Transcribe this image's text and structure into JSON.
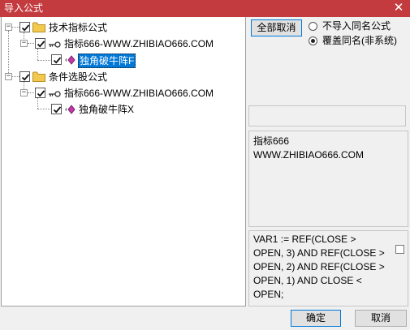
{
  "window": {
    "title": "导入公式"
  },
  "tree": {
    "nodes": [
      {
        "label": "技术指标公式",
        "expander": "−",
        "checked": true,
        "icon": "folder-icon"
      },
      {
        "label": "指标666-WWW.ZHIBIAO666.COM",
        "expander": "−",
        "checked": true,
        "icon": "key-icon"
      },
      {
        "label": "独角破牛阵F",
        "expander": "",
        "checked": true,
        "icon": "diamond-icon",
        "selected": true
      },
      {
        "label": "条件选股公式",
        "expander": "−",
        "checked": true,
        "icon": "folder-icon"
      },
      {
        "label": "指标666-WWW.ZHIBIAO666.COM",
        "expander": "−",
        "checked": true,
        "icon": "key-icon"
      },
      {
        "label": "独角破牛阵X",
        "expander": "",
        "checked": true,
        "icon": "diamond-icon"
      }
    ]
  },
  "actions": {
    "cancel_all_label": "全部取消"
  },
  "options": {
    "no_import_same_name": {
      "label": "不导入同名公式",
      "selected": false
    },
    "overwrite_same_name": {
      "label": "覆盖同名(非系统)",
      "selected": true
    }
  },
  "description": {
    "lines": [
      "指标666",
      "WWW.ZHIBIAO666.COM"
    ]
  },
  "code": {
    "lines": [
      "VAR1 := REF(CLOSE >",
      "OPEN, 3) AND REF(CLOSE >",
      "OPEN, 2) AND REF(CLOSE >",
      "OPEN, 1) AND CLOSE <",
      "OPEN;"
    ],
    "checked": false
  },
  "footer": {
    "ok_label": "确定",
    "cancel_label": "取消"
  },
  "colors": {
    "titlebar": "#c43b3f",
    "selection": "#0078d7",
    "folder": "#f2c94c",
    "diamond": "#c03aa8"
  }
}
